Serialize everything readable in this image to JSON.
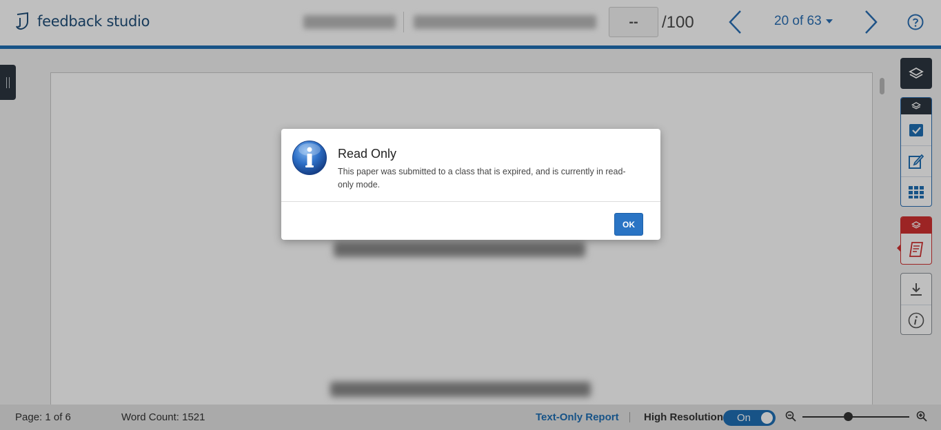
{
  "header": {
    "brand": "feedback studio",
    "score_value": "--",
    "score_max": "/100",
    "page_selector": "20 of 63"
  },
  "footer": {
    "page": "Page: 1 of 6",
    "word_count": "Word Count: 1521",
    "text_only_report": "Text-Only Report",
    "high_resolution": "High Resolution",
    "toggle_state": "On"
  },
  "dialog": {
    "title": "Read Only",
    "message": "This paper was submitted to a class that is expired, and is currently in read-only mode.",
    "ok_label": "OK"
  },
  "colors": {
    "accent": "#1f6fb5",
    "dark_toolbar": "#2d3640",
    "alert_red": "#d03030"
  },
  "icons": [
    "logo-icon",
    "prev-arrow-icon",
    "next-arrow-icon",
    "dropdown-caret-icon",
    "help-icon",
    "layers-icon",
    "checkbox-icon",
    "edit-icon",
    "grid-icon",
    "document-icon",
    "download-icon",
    "info-icon",
    "zoom-out-icon",
    "zoom-in-icon"
  ]
}
